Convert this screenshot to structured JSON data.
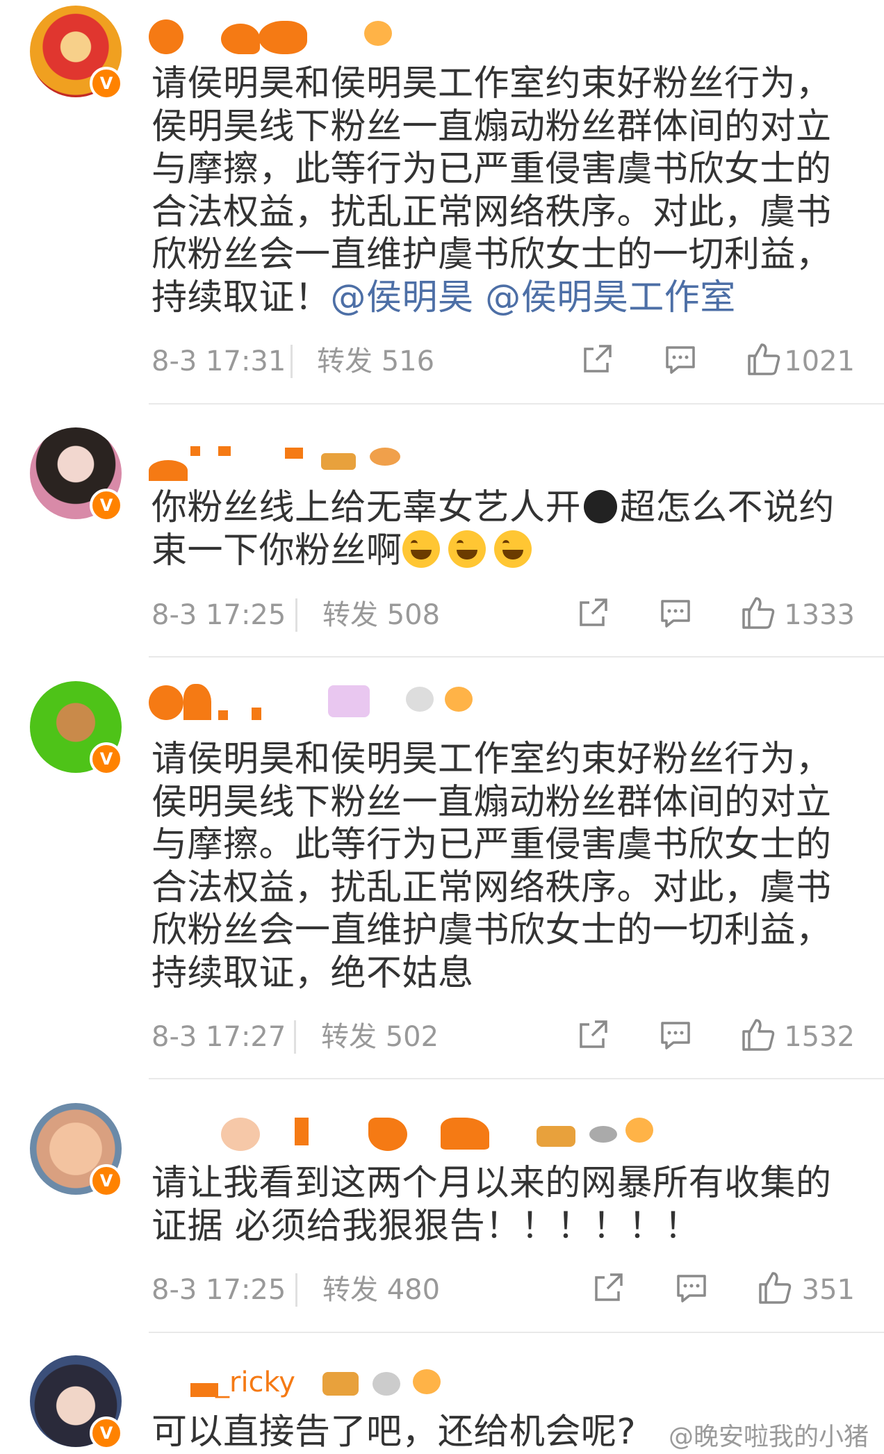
{
  "comments": [
    {
      "text": "请侯明昊和侯明昊工作室约束好粉丝行为，侯明昊线下粉丝一直煽动粉丝群体间的对立与摩擦，此等行为已严重侵害虞书欣女士的合法权益，扰乱正常网络秩序。对此，虞书欣粉丝会一直维护虞书欣女士的一切利益，持续取证！",
      "mention1": "@侯明昊",
      "mention2": "@侯明昊工作室",
      "time": "8-3 17:31",
      "repost": "转发 516",
      "likes": "1021",
      "badge": "V"
    },
    {
      "text_a": "你粉丝线上给无辜女艺人开",
      "text_b": "超怎么不说约束一下你粉丝啊",
      "time": "8-3 17:25",
      "repost": "转发 508",
      "likes": "1333",
      "badge": "V"
    },
    {
      "text": "请侯明昊和侯明昊工作室约束好粉丝行为，侯明昊线下粉丝一直煽动粉丝群体间的对立与摩擦。此等行为已严重侵害虞书欣女士的合法权益，扰乱正常网络秩序。对此，虞书欣粉丝会一直维护虞书欣女士的一切利益，持续取证，绝不姑息",
      "time": "8-3 17:27",
      "repost": "转发 502",
      "likes": "1532",
      "badge": "V"
    },
    {
      "text": "请让我看到这两个月以来的网暴所有收集的证据 必须给我狠狠告！！！！！！",
      "time": "8-3 17:25",
      "repost": "转发 480",
      "likes": "351",
      "badge": "V"
    },
    {
      "username_partial": "_ricky",
      "text": "可以直接告了吧，还给机会呢?",
      "badge": "V"
    }
  ],
  "watermark": "@晚安啦我的小猪",
  "icons": [
    "share-icon",
    "comment-icon",
    "like-icon"
  ],
  "colors": {
    "accent": "#ff8200",
    "link": "#4d6fa6",
    "meta": "#999999",
    "text": "#333333"
  }
}
